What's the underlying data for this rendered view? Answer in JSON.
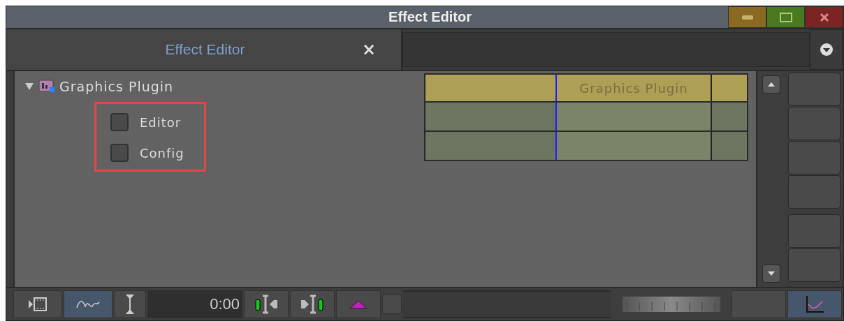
{
  "window": {
    "title": "Effect Editor"
  },
  "tabs": [
    {
      "label": "Effect Editor",
      "selected": true,
      "close": "×"
    }
  ],
  "tree": {
    "label": "Graphics Plugin",
    "expanded": true,
    "highlighted": true,
    "children": [
      {
        "label": "Editor",
        "checked": false
      },
      {
        "label": "Config",
        "checked": false
      }
    ]
  },
  "timeline": {
    "header": "Graphics Plugin"
  },
  "toolbar": {
    "time": "0:00",
    "buttons": [
      {
        "kind": "film",
        "selected": false
      },
      {
        "kind": "curve",
        "selected": true
      },
      {
        "kind": "ibeam",
        "selected": false
      }
    ],
    "graph_selected": true
  }
}
